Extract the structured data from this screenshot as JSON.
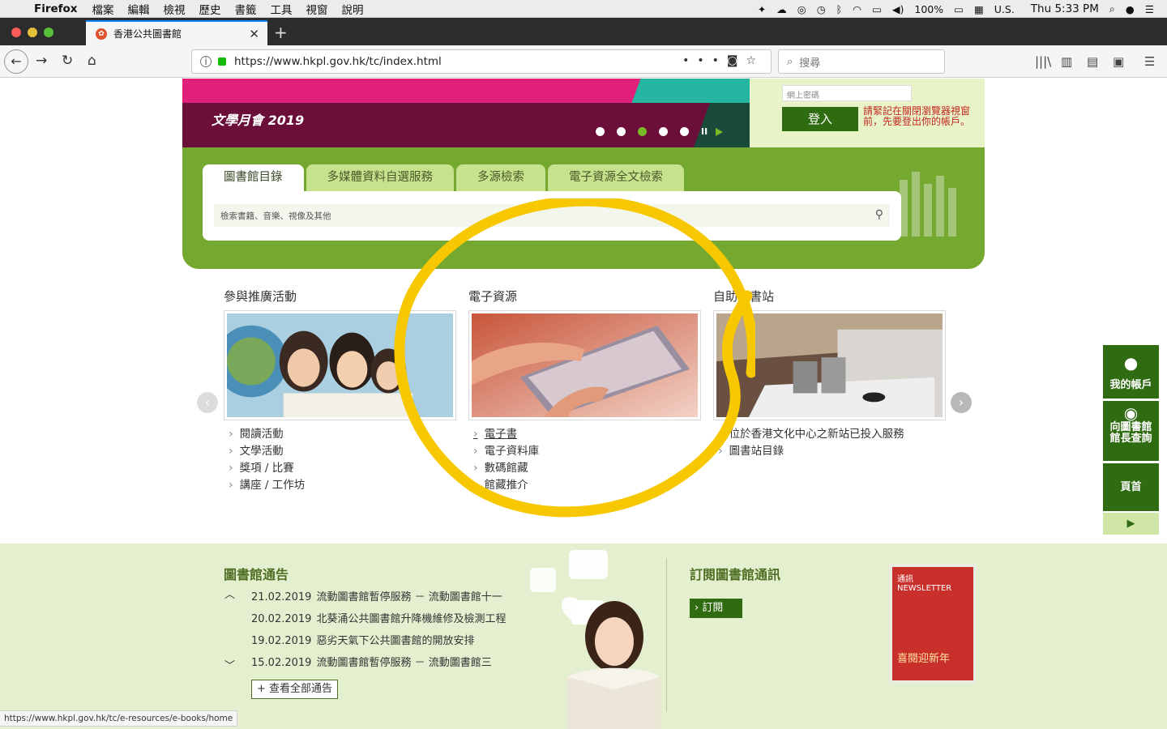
{
  "menubar": {
    "app": "Firefox",
    "items": [
      "檔案",
      "編輯",
      "檢視",
      "歷史",
      "書籤",
      "工具",
      "視窗",
      "說明"
    ],
    "battery": "100%",
    "input_source": "U.S.",
    "clock": "Thu 5:33 PM"
  },
  "browser": {
    "tab_title": "香港公共圖書館",
    "url": "https://www.hkpl.gov.hk/tc/index.html",
    "search_placeholder": "搜尋"
  },
  "banner": {
    "title": "文學月會 2019"
  },
  "login": {
    "password_placeholder": "網上密碼",
    "login_button": "登入",
    "note": "請緊記在關閉瀏覽器視窗前，先要登出你的帳戶。"
  },
  "search": {
    "tabs": [
      "圖書館目錄",
      "多媒體資料自選服務",
      "多源檢索",
      "電子資源全文檢索"
    ],
    "placeholder": "檢索書籍、音樂、視像及其他"
  },
  "columns": [
    {
      "title": "參與推廣活動",
      "links": [
        "閱讀活動",
        "文學活動",
        "獎項 / 比賽",
        "講座 / 工作坊"
      ]
    },
    {
      "title": "電子資源",
      "links": [
        "電子書",
        "電子資料庫",
        "數碼館藏",
        "館藏推介"
      ]
    },
    {
      "title": "自助圖書站",
      "links": [
        "位於香港文化中心之新站已投入服務",
        "圖書站目錄"
      ]
    }
  ],
  "side": {
    "account": "我的帳戶",
    "ask": "向圖書館館長查詢",
    "top": "頁首"
  },
  "notices": {
    "title": "圖書館通告",
    "items": [
      {
        "date": "21.02.2019",
        "text": "流動圖書館暫停服務 － 流動圖書館十一"
      },
      {
        "date": "20.02.2019",
        "text": "北葵涌公共圖書館升降機維修及檢測工程"
      },
      {
        "date": "19.02.2019",
        "text": "惡劣天氣下公共圖書館的開放安排"
      },
      {
        "date": "15.02.2019",
        "text": "流動圖書館暫停服務 － 流動圖書館三"
      }
    ],
    "view_all": "+ 查看全部通告"
  },
  "newsletter": {
    "title": "訂閱圖書館通訊",
    "subscribe": "› 訂閱",
    "cover_title": "通訊 NEWSLETTER",
    "cover_caption": "喜閱迎新年"
  },
  "statusbar": {
    "url": "https://www.hkpl.gov.hk/tc/e-resources/e-books/home"
  },
  "colors": {
    "brand_green": "#2f6b11",
    "panel_green": "#75a82f",
    "highlight_yellow": "#f7c800"
  }
}
